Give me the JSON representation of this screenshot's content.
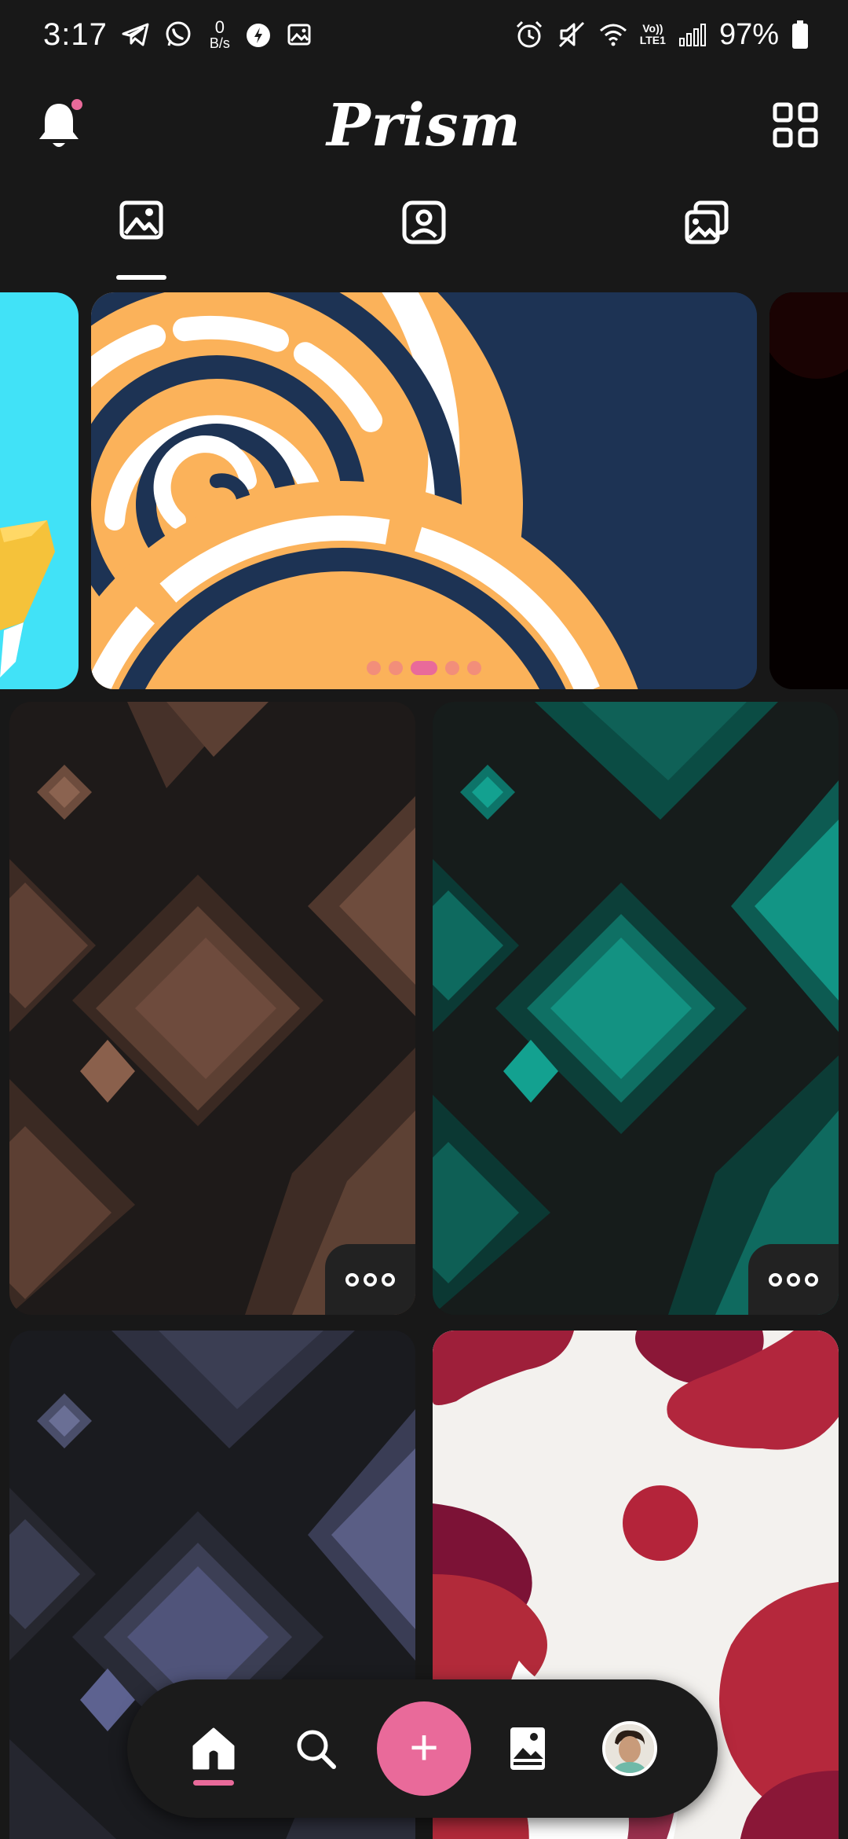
{
  "status_bar": {
    "time": "3:17",
    "net_speed_value": "0",
    "net_speed_unit": "B/s",
    "volte_top": "Vo))",
    "volte_bottom": "LTE1",
    "battery_percent": "97%",
    "icons": [
      "telegram-icon",
      "whatsapp-icon",
      "net-speed",
      "app-icon",
      "image-icon",
      "alarm-icon",
      "mute-icon",
      "wifi-icon",
      "volte-icon",
      "signal-icon",
      "battery-icon"
    ]
  },
  "app_bar": {
    "title": "Prism",
    "has_notification": true
  },
  "tabs": [
    {
      "icon": "wallpapers-tab-icon",
      "selected": true
    },
    {
      "icon": "profile-tab-icon",
      "selected": false
    },
    {
      "icon": "collections-tab-icon",
      "selected": false
    }
  ],
  "carousel": {
    "slides": 3,
    "dots_total": 5,
    "active_dot": 3
  },
  "colors": {
    "background": "#181818",
    "accent": "#e96a9a",
    "carousel_navy": "#1d3354",
    "carousel_orange": "#fbb25a",
    "tile_brown": "#6b4636",
    "tile_teal": "#0c8a7a",
    "tile_slate": "#565a78",
    "tile_crimson": "#a8223a"
  },
  "bottom_nav": {
    "items": [
      "home-icon",
      "search-icon",
      "add-icon",
      "gallery-icon",
      "avatar"
    ],
    "add_label": "+",
    "active": "home"
  }
}
